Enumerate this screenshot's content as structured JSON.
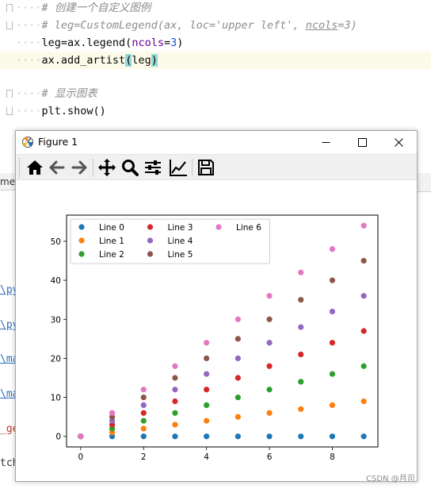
{
  "editor": {
    "lines": [
      {
        "indent": "····",
        "comment": "# 创建一个自定义图例"
      },
      {
        "indent": "····",
        "comment_parts": [
          "# leg=CustomLegend(ax, loc='upper left', ",
          "ncols",
          "=3)"
        ]
      },
      {
        "indent": "····",
        "code_parts": [
          "leg=ax.legend(",
          "ncols",
          "=",
          "3",
          ")"
        ]
      },
      {
        "indent": "····",
        "code_parts": [
          "ax.add_artist",
          "(",
          "leg",
          ")"
        ]
      },
      {
        "indent": "",
        "code_parts": []
      },
      {
        "indent": "····",
        "comment": "# 显示图表"
      },
      {
        "indent": "····",
        "code_parts": [
          "plt.show()"
        ]
      }
    ]
  },
  "left_panel": {
    "tab_label": "me",
    "fragments": [
      "\\py",
      "\\py",
      "\\ma",
      "\\ma",
      "_ge",
      "tch"
    ]
  },
  "window": {
    "title": "Figure 1",
    "buttons": [
      "minimize",
      "maximize",
      "close"
    ]
  },
  "toolbar": {
    "tools": [
      "home-icon",
      "back-icon",
      "forward-icon",
      "pan-icon",
      "zoom-icon",
      "subplots-config-icon",
      "edit-axes-icon",
      "save-icon"
    ]
  },
  "chart_data": {
    "type": "scatter",
    "title": "",
    "xlabel": "",
    "ylabel": "",
    "xlim": [
      -0.45,
      9.45
    ],
    "ylim": [
      -2.7,
      56.7
    ],
    "xticks": [
      0,
      2,
      4,
      6,
      8
    ],
    "yticks": [
      0,
      10,
      20,
      30,
      40,
      50
    ],
    "x": [
      0,
      1,
      2,
      3,
      4,
      5,
      6,
      7,
      8,
      9
    ],
    "series": [
      {
        "name": "Line 0",
        "color": "#1f77b4",
        "values": [
          0,
          0,
          0,
          0,
          0,
          0,
          0,
          0,
          0,
          0
        ]
      },
      {
        "name": "Line 1",
        "color": "#ff7f0e",
        "values": [
          0,
          1,
          2,
          3,
          4,
          5,
          6,
          7,
          8,
          9
        ]
      },
      {
        "name": "Line 2",
        "color": "#2ca02c",
        "values": [
          0,
          2,
          4,
          6,
          8,
          10,
          12,
          14,
          16,
          18
        ]
      },
      {
        "name": "Line 3",
        "color": "#d62728",
        "values": [
          0,
          3,
          6,
          9,
          12,
          15,
          18,
          21,
          24,
          27
        ]
      },
      {
        "name": "Line 4",
        "color": "#9467bd",
        "values": [
          0,
          4,
          8,
          12,
          16,
          20,
          24,
          28,
          32,
          36
        ]
      },
      {
        "name": "Line 5",
        "color": "#8c564b",
        "values": [
          0,
          5,
          10,
          15,
          20,
          25,
          30,
          35,
          40,
          45
        ]
      },
      {
        "name": "Line 6",
        "color": "#e377c2",
        "values": [
          0,
          6,
          12,
          18,
          24,
          30,
          36,
          42,
          48,
          54
        ]
      }
    ],
    "legend": {
      "placement": "upper-left",
      "columns": 3
    },
    "grid": false
  },
  "watermark": "CSDN @月司"
}
